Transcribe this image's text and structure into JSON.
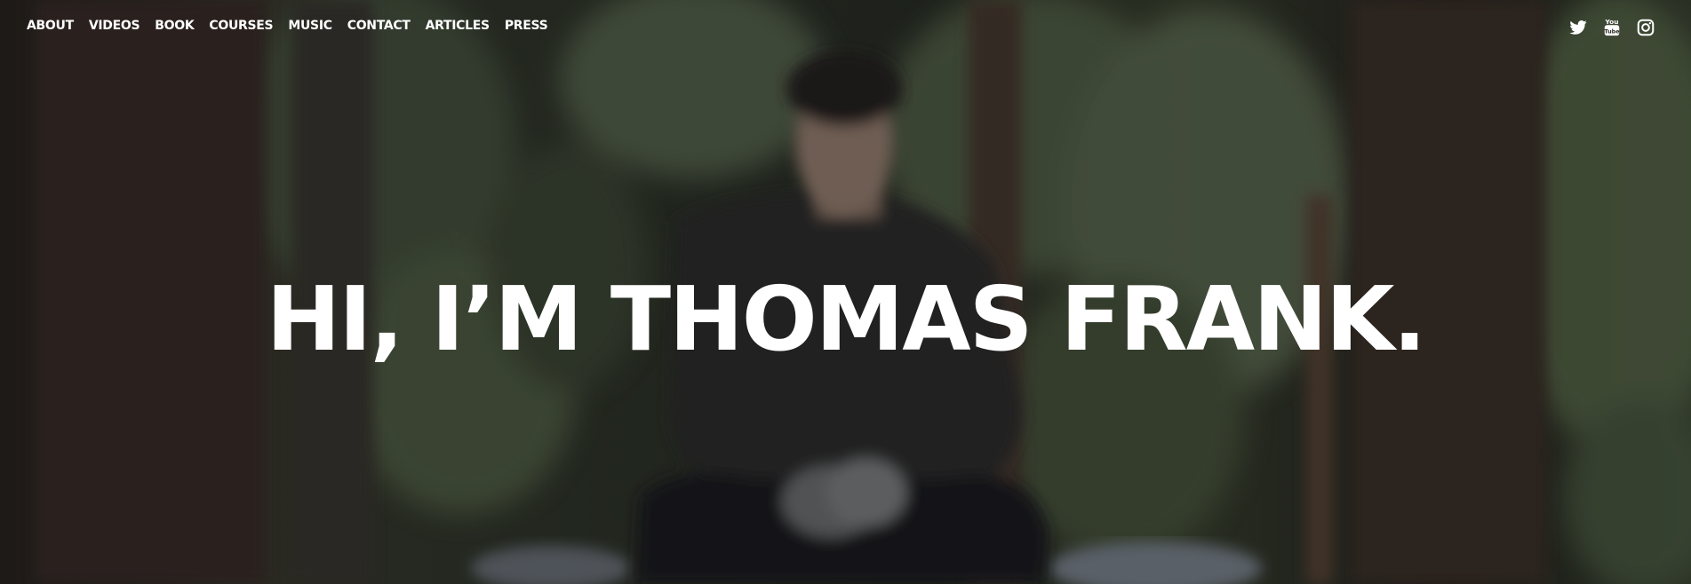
{
  "nav": {
    "items": [
      {
        "label": "ABOUT"
      },
      {
        "label": "VIDEOS"
      },
      {
        "label": "BOOK"
      },
      {
        "label": "COURSES"
      },
      {
        "label": "MUSIC"
      },
      {
        "label": "CONTACT"
      },
      {
        "label": "ARTICLES"
      },
      {
        "label": "PRESS"
      }
    ]
  },
  "social": {
    "icons": [
      "twitter-icon",
      "youtube-icon",
      "instagram-icon"
    ]
  },
  "hero": {
    "headline": "HI, I’M THOMAS FRANK."
  }
}
